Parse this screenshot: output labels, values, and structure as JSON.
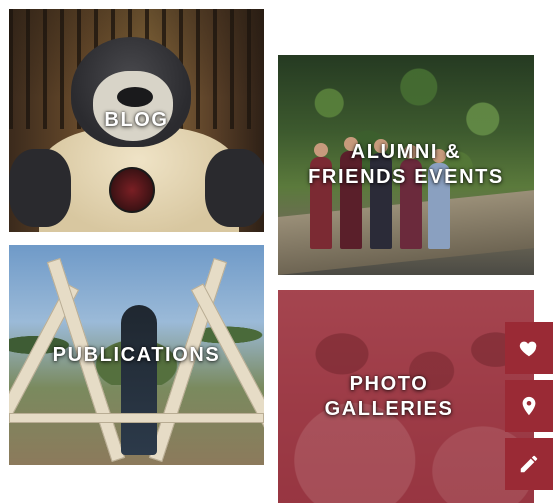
{
  "tiles": [
    {
      "id": "blog",
      "label": "BLOG"
    },
    {
      "id": "alumni",
      "label": "ALUMNI &\nFRIENDS EVENTS"
    },
    {
      "id": "publications",
      "label": "PUBLICATIONS"
    },
    {
      "id": "photos",
      "label": "PHOTO\nGALLERIES"
    }
  ],
  "rail": {
    "items": [
      {
        "icon": "heart-icon"
      },
      {
        "icon": "location-pin-icon"
      },
      {
        "icon": "pencil-icon"
      }
    ]
  },
  "colors": {
    "accent": "#9a2a35",
    "photo_tint": "#a34a55",
    "label_text": "#ffffff"
  }
}
